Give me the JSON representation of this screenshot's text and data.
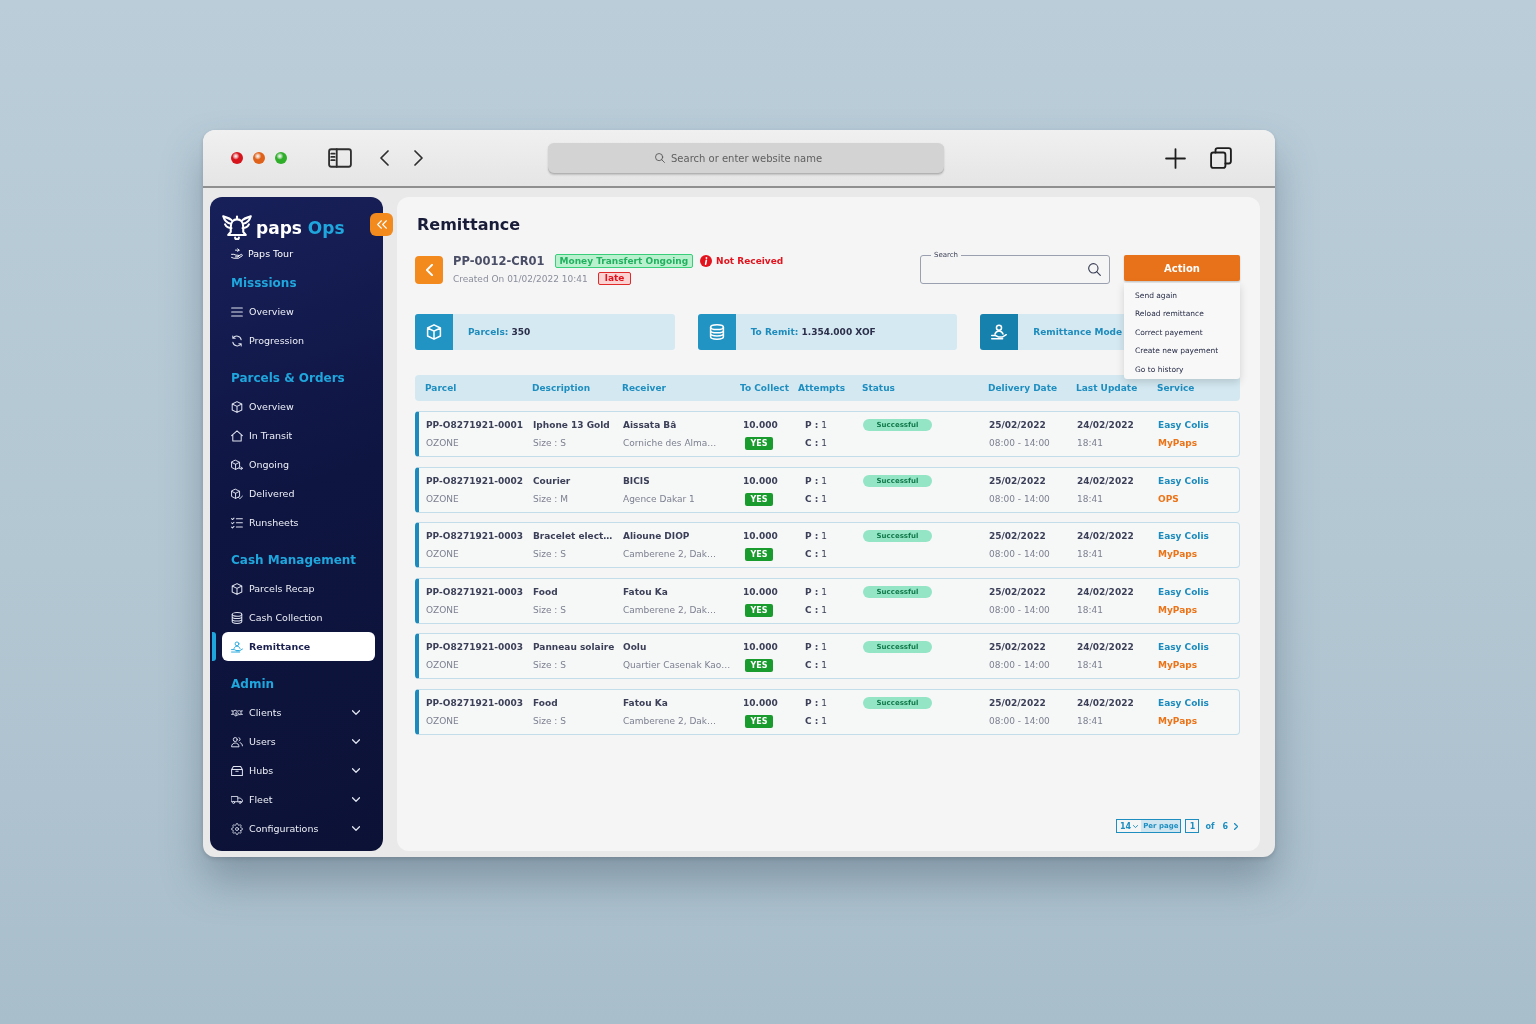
{
  "browser": {
    "address_placeholder": "Search or enter website name"
  },
  "sidebar": {
    "brand": {
      "name": "paps",
      "suffix": "Ops"
    },
    "tour": "Paps Tour",
    "sections": [
      {
        "title": "Misssions",
        "items": [
          {
            "label": "Overview",
            "selected": false
          },
          {
            "label": "Progression",
            "selected": false
          }
        ]
      },
      {
        "title": "Parcels & Orders",
        "items": [
          {
            "label": "Overview",
            "selected": false
          },
          {
            "label": "In Transit",
            "selected": false
          },
          {
            "label": "Ongoing",
            "selected": false
          },
          {
            "label": "Delivered",
            "selected": false
          },
          {
            "label": "Runsheets",
            "selected": false
          }
        ]
      },
      {
        "title": "Cash Management",
        "items": [
          {
            "label": "Parcels Recap",
            "selected": false
          },
          {
            "label": "Cash Collection",
            "selected": false
          },
          {
            "label": "Remittance",
            "selected": true
          }
        ]
      },
      {
        "title": "Admin",
        "items": [
          {
            "label": "Clients",
            "selected": false,
            "expanded": false
          },
          {
            "label": "Users",
            "selected": false,
            "expanded": false
          },
          {
            "label": "Hubs",
            "selected": false,
            "expanded": false
          },
          {
            "label": "Fleet",
            "selected": false,
            "expanded": false
          },
          {
            "label": "Configurations",
            "selected": false,
            "expanded": false
          }
        ]
      }
    ]
  },
  "page": {
    "title": "Remittance"
  },
  "remittance": {
    "reference": "PP-0012-CR01",
    "transfer_status": "Money Transfert Ongoing",
    "receipt_status": "Not Received",
    "created": "Created On 01/02/2022 10:41",
    "delay_badge": "late"
  },
  "search": {
    "label": "Search"
  },
  "action": {
    "label": "Action",
    "expanded": true,
    "menu": [
      "Send again",
      "Reload remittance",
      "Correct payement",
      "Create new payement",
      "Go to history"
    ]
  },
  "stats": [
    {
      "label": "Parcels:",
      "value": "350"
    },
    {
      "label": "To Remit:",
      "value": "1.354.000 XOF"
    },
    {
      "label": "Remittance Mode"
    }
  ],
  "table": {
    "columns": [
      "Parcel",
      "Description",
      "Receiver",
      "To Collect",
      "Attempts",
      "Status",
      "Delivery Date",
      "Last Update",
      "Service"
    ],
    "rows": [
      {
        "parcel": "PP-O8271921-0001",
        "client": "OZONE",
        "description": "Iphone 13 Gold",
        "size": "Size : S",
        "receiver": "Aissata Bâ",
        "address": "Corniche des Alma…",
        "to_collect": "10.000",
        "collected": "YES",
        "attempts_pickup": "**P :** 1",
        "attempts_delivery": "**C :** 1",
        "status": "Successful",
        "delivery_date": "25/02/2022",
        "delivery_window": "08:00 - 14:00",
        "last_update_date": "24/02/2022",
        "last_update_time": "18:41",
        "service": "Easy Colis",
        "provider": "MyPaps"
      },
      {
        "parcel": "PP-O8271921-0002",
        "client": "OZONE",
        "description": "Courier",
        "size": "Size : M",
        "receiver": "BICIS",
        "address": "Agence Dakar 1",
        "to_collect": "10.000",
        "collected": "YES",
        "attempts_pickup": "**P :** 1",
        "attempts_delivery": "**C :** 1",
        "status": "Successful",
        "delivery_date": "25/02/2022",
        "delivery_window": "08:00 - 14:00",
        "last_update_date": "24/02/2022",
        "last_update_time": "18:41",
        "service": "Easy Colis",
        "provider": "OPS"
      },
      {
        "parcel": "PP-O8271921-0003",
        "client": "OZONE",
        "description": "Bracelet elect…",
        "size": "Size : S",
        "receiver": "Alioune DIOP",
        "address": "Camberene 2, Dak…",
        "to_collect": "10.000",
        "collected": "YES",
        "attempts_pickup": "**P :** 1",
        "attempts_delivery": "**C :** 1",
        "status": "Successful",
        "delivery_date": "25/02/2022",
        "delivery_window": "08:00 - 14:00",
        "last_update_date": "24/02/2022",
        "last_update_time": "18:41",
        "service": "Easy Colis",
        "provider": "MyPaps"
      },
      {
        "parcel": "PP-O8271921-0003",
        "client": "OZONE",
        "description": "Food",
        "size": "Size : S",
        "receiver": "Fatou Ka",
        "address": "Camberene 2, Dak…",
        "to_collect": "10.000",
        "collected": "YES",
        "attempts_pickup": "**P :** 1",
        "attempts_delivery": "**C :** 1",
        "status": "Successful",
        "delivery_date": "25/02/2022",
        "delivery_window": "08:00 - 14:00",
        "last_update_date": "24/02/2022",
        "last_update_time": "18:41",
        "service": "Easy Colis",
        "provider": "MyPaps"
      },
      {
        "parcel": "PP-O8271921-0003",
        "client": "OZONE",
        "description": "Panneau solaire",
        "size": "Size : S",
        "receiver": "Oolu",
        "address": "Quartier Casenak Kao…",
        "to_collect": "10.000",
        "collected": "YES",
        "attempts_pickup": "**P :** 1",
        "attempts_delivery": "**C :** 1",
        "status": "Successful",
        "delivery_date": "25/02/2022",
        "delivery_window": "08:00 - 14:00",
        "last_update_date": "24/02/2022",
        "last_update_time": "18:41",
        "service": "Easy Colis",
        "provider": "MyPaps"
      },
      {
        "parcel": "PP-O8271921-0003",
        "client": "OZONE",
        "description": "Food",
        "size": "Size : S",
        "receiver": "Fatou Ka",
        "address": "Camberene 2, Dak…",
        "to_collect": "10.000",
        "collected": "YES",
        "attempts_pickup": "**P :** 1",
        "attempts_delivery": "**C :** 1",
        "status": "Successful",
        "delivery_date": "25/02/2022",
        "delivery_window": "08:00 - 14:00",
        "last_update_date": "24/02/2022",
        "last_update_time": "18:41",
        "service": "Easy Colis",
        "provider": "MyPaps"
      }
    ]
  },
  "pagination": {
    "per_page": "14",
    "per_page_label": "Per page",
    "page": "1",
    "of_label": "of",
    "total_pages": "6"
  }
}
